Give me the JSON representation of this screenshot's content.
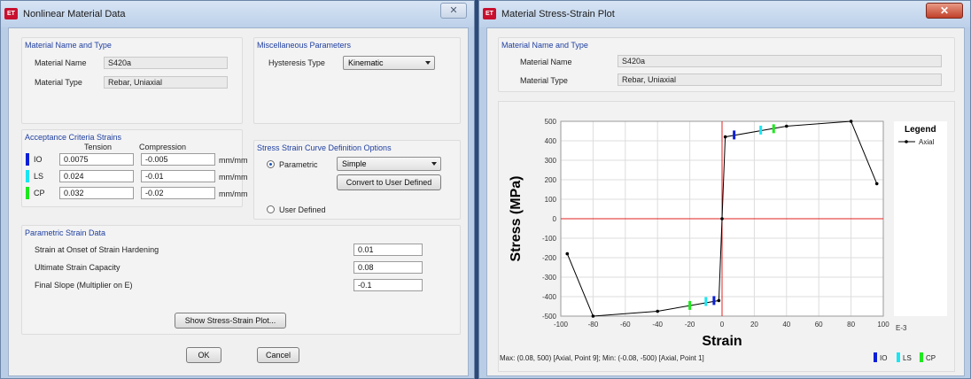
{
  "left_window": {
    "title": "Nonlinear Material Data",
    "material_group": {
      "title": "Material Name and Type",
      "name_label": "Material Name",
      "name_value": "S420a",
      "type_label": "Material Type",
      "type_value": "Rebar, Uniaxial"
    },
    "misc_group": {
      "title": "Miscellaneous Parameters",
      "hysteresis_label": "Hysteresis Type",
      "hysteresis_value": "Kinematic"
    },
    "acceptance": {
      "title": "Acceptance Criteria Strains",
      "tension_header": "Tension",
      "compression_header": "Compression",
      "rows": [
        {
          "code": "IO",
          "color": "#0a1fd6",
          "tension": "0.0075",
          "compression": "-0.005",
          "unit": "mm/mm"
        },
        {
          "code": "LS",
          "color": "#19e6f2",
          "tension": "0.024",
          "compression": "-0.01",
          "unit": "mm/mm"
        },
        {
          "code": "CP",
          "color": "#1ee81e",
          "tension": "0.032",
          "compression": "-0.02",
          "unit": "mm/mm"
        }
      ]
    },
    "curve_options": {
      "title": "Stress Strain Curve Definition Options",
      "parametric_label": "Parametric",
      "parametric_value": "Simple",
      "convert_button": "Convert to User Defined",
      "user_defined_label": "User Defined"
    },
    "parametric": {
      "title": "Parametric Strain Data",
      "rows": [
        {
          "label": "Strain at Onset of Strain Hardening",
          "value": "0.01"
        },
        {
          "label": "Ultimate Strain Capacity",
          "value": "0.08"
        },
        {
          "label": "Final Slope (Multiplier on E)",
          "value": "-0.1"
        }
      ],
      "plot_button": "Show Stress-Strain Plot..."
    },
    "ok_button": "OK",
    "cancel_button": "Cancel"
  },
  "right_window": {
    "title": "Material Stress-Strain Plot",
    "material_group": {
      "title": "Material Name and Type",
      "name_label": "Material Name",
      "name_value": "S420a",
      "type_label": "Material Type",
      "type_value": "Rebar, Uniaxial"
    },
    "status_text": "Max: (0.08, 500)   [Axial, Point 9];   Min: (-0.08, -500)   [Axial, Point 1]",
    "legend_bottom": [
      {
        "code": "IO",
        "color": "#0a1fd6"
      },
      {
        "code": "LS",
        "color": "#19e6f2"
      },
      {
        "code": "CP",
        "color": "#1ee81e"
      }
    ]
  },
  "chart_data": {
    "type": "line",
    "xlabel": "Strain",
    "ylabel": "Stress (MPa)",
    "x_unit": "E-3",
    "xlim": [
      -100,
      100
    ],
    "ylim": [
      -500,
      500
    ],
    "xticks": [
      -100,
      -80,
      -60,
      -40,
      -20,
      0,
      20,
      40,
      60,
      80,
      100
    ],
    "yticks": [
      -500,
      -400,
      -300,
      -200,
      -100,
      0,
      100,
      200,
      300,
      400,
      500
    ],
    "legend_title": "Legend",
    "series": [
      {
        "name": "Axial",
        "color": "#000000",
        "points": [
          [
            -96,
            -180
          ],
          [
            -80,
            -500
          ],
          [
            -40,
            -475
          ],
          [
            -2,
            -420
          ],
          [
            0,
            0
          ],
          [
            2,
            420
          ],
          [
            40,
            475
          ],
          [
            80,
            500
          ],
          [
            96,
            180
          ]
        ]
      }
    ],
    "acceptance_marks": [
      {
        "code": "IO",
        "color": "#0a1fd6",
        "x": 7.5,
        "y": 430
      },
      {
        "code": "LS",
        "color": "#19e6f2",
        "x": 24,
        "y": 455
      },
      {
        "code": "CP",
        "color": "#1ee81e",
        "x": 32,
        "y": 462
      },
      {
        "code": "IO",
        "color": "#0a1fd6",
        "x": -5,
        "y": -420
      },
      {
        "code": "LS",
        "color": "#19e6f2",
        "x": -10,
        "y": -425
      },
      {
        "code": "CP",
        "color": "#1ee81e",
        "x": -20,
        "y": -445
      }
    ],
    "grid": true
  }
}
